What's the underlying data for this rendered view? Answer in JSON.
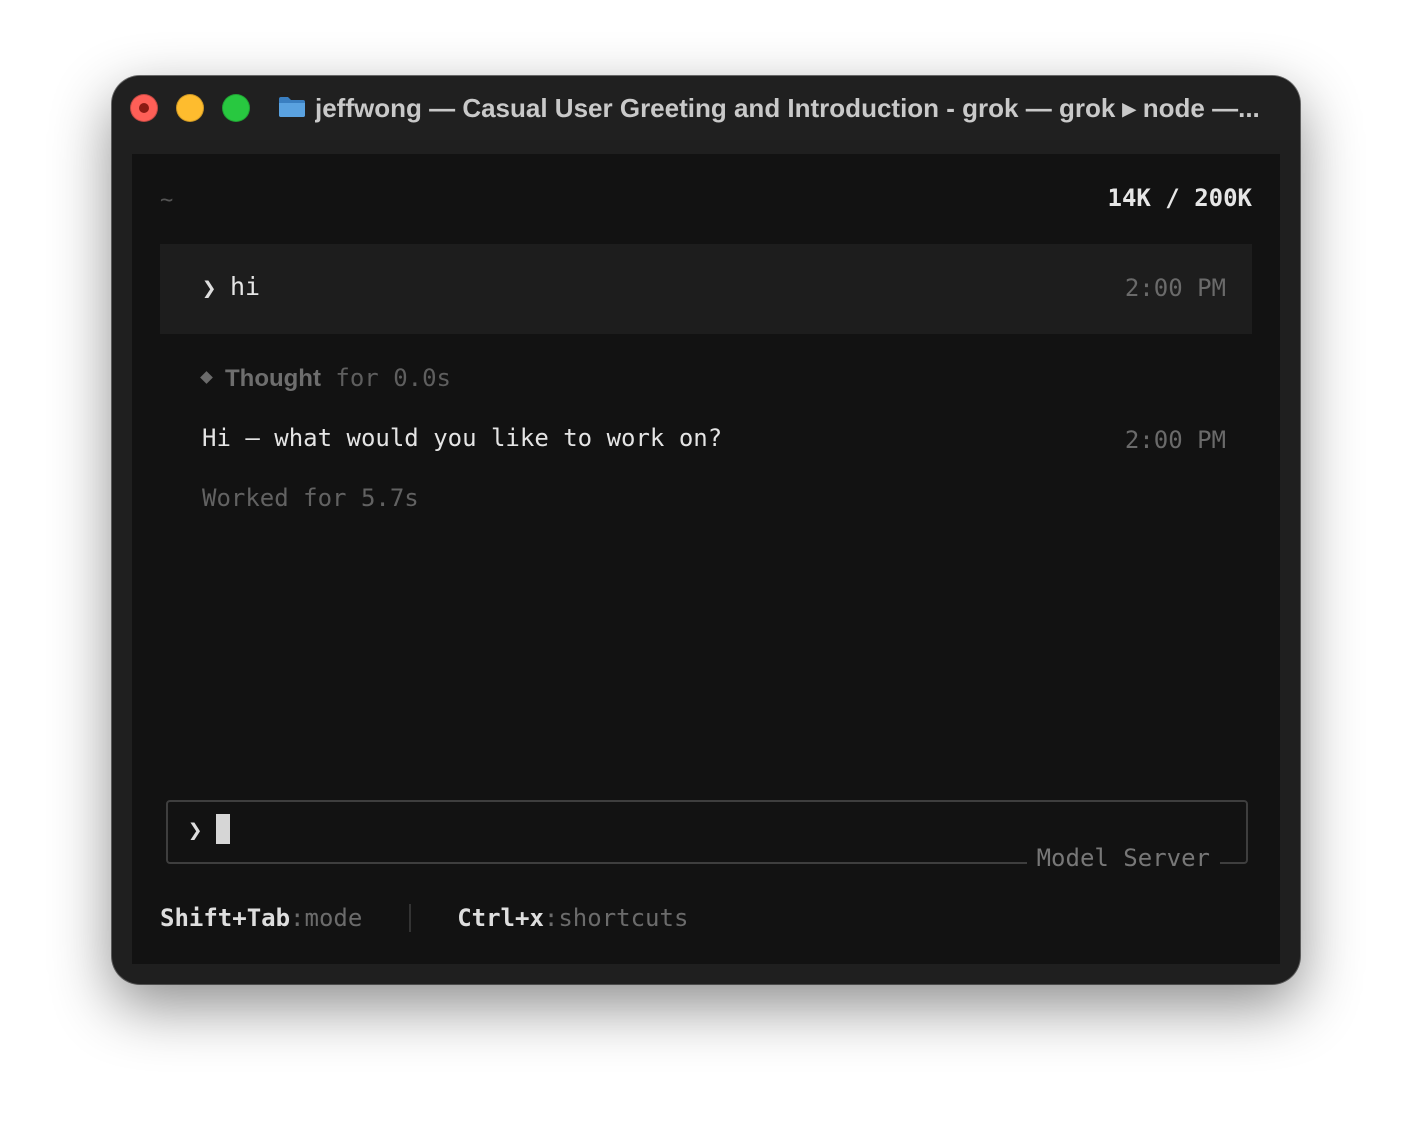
{
  "window": {
    "title": "jeffwong — Casual User Greeting and Introduction - grok — grok ▸ node —..."
  },
  "header": {
    "cwd": "~",
    "tokens": "14K / 200K"
  },
  "user_message": {
    "prompt": "❯",
    "text": "hi",
    "time": "2:00 PM"
  },
  "thought": {
    "label": "Thought",
    "duration": "for 0.0s"
  },
  "assistant_message": {
    "text": "Hi — what would you like to work on?",
    "time": "2:00 PM"
  },
  "worked": "Worked for 5.7s",
  "input": {
    "prompt": "❯",
    "model_label": "Model Server"
  },
  "footer": {
    "shortcut1_key": "Shift+Tab",
    "shortcut1_action": "mode",
    "shortcut2_key": "Ctrl+x",
    "shortcut2_action": "shortcuts"
  },
  "colors": {
    "traffic_red": "#fe5f57",
    "traffic_yellow": "#febc2e",
    "traffic_green": "#28c840",
    "terminal_bg": "#121212"
  },
  "icons": {
    "folder": "folder-icon",
    "thought": "diamond-icon"
  }
}
